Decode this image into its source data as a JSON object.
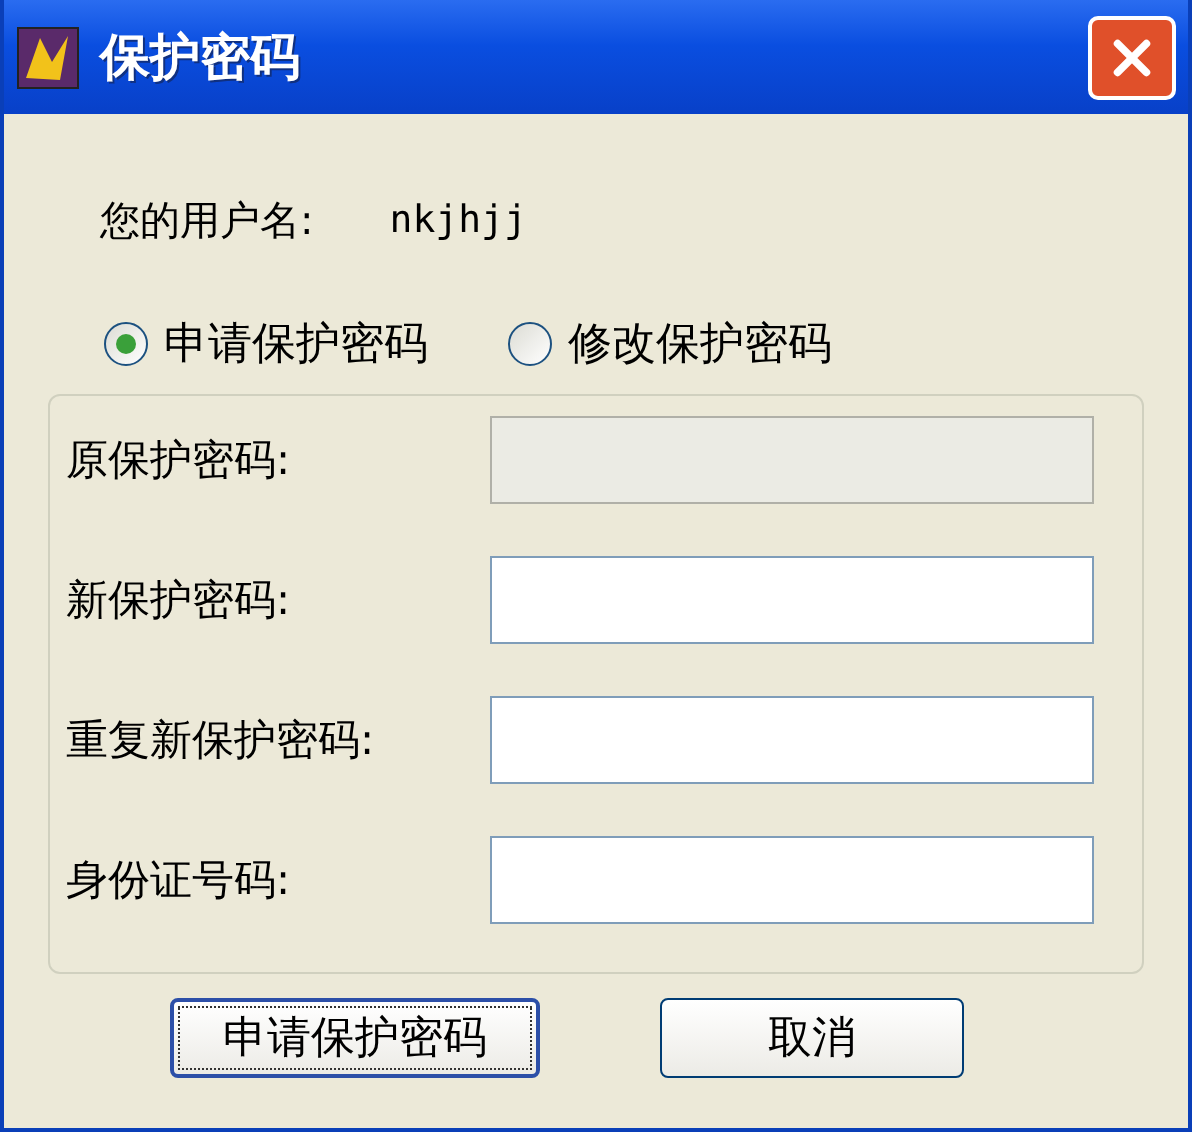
{
  "window": {
    "title": "保护密码"
  },
  "username": {
    "label": "您的用户名:",
    "value": "nkjhjj"
  },
  "radios": [
    {
      "label": "申请保护密码",
      "selected": true
    },
    {
      "label": "修改保护密码",
      "selected": false
    }
  ],
  "fields": [
    {
      "label": "原保护密码:",
      "disabled": true
    },
    {
      "label": "新保护密码:",
      "disabled": false
    },
    {
      "label": "重复新保护密码:",
      "disabled": false
    },
    {
      "label": "身份证号码:",
      "disabled": false
    }
  ],
  "buttons": [
    {
      "label": "申请保护密码",
      "default": true
    },
    {
      "label": "取消",
      "default": false
    }
  ]
}
